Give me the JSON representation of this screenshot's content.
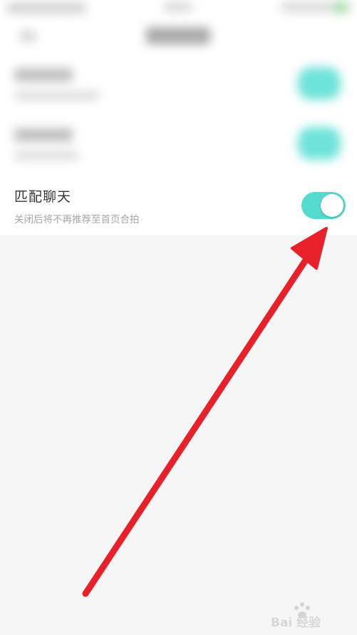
{
  "setting": {
    "title": "匹配聊天",
    "description": "关闭后将不再推荐至首页合拍",
    "enabled": true
  },
  "watermark": {
    "text": "Bai 经验"
  },
  "colors": {
    "toggle_on": "#56dccf",
    "arrow": "#e8202a",
    "background": "#f6f6f6"
  },
  "icons": {
    "arrow": "red-arrow-annotation-icon",
    "watermark_paw": "paw-icon"
  }
}
